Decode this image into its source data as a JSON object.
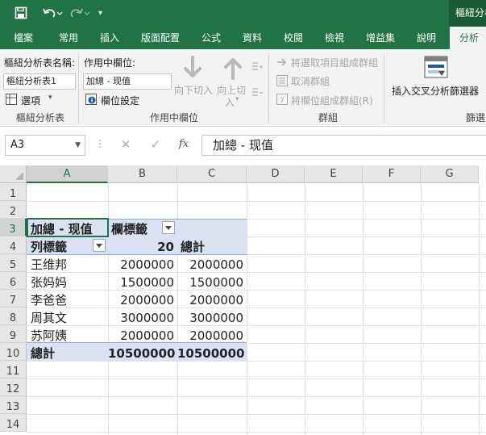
{
  "titlebar": {
    "app_title": "樞紐分析表工具"
  },
  "tabs": [
    "檔案",
    "常用",
    "插入",
    "版面配置",
    "公式",
    "資料",
    "校閱",
    "檢視",
    "增益集",
    "說明",
    "分析"
  ],
  "ribbon": {
    "pivot_name_label": "樞紐分析表名稱:",
    "pivot_name_value": "樞紐分析表1",
    "options_label": "選項",
    "active_field_label": "作用中欄位:",
    "active_field_value": "加總 - 现值",
    "field_settings_label": "欄位設定",
    "drill_down_label": "向下切入",
    "drill_up_label_1": "向上切",
    "drill_up_label_2": "入",
    "group_selection_label": "將選取項目組成群組",
    "ungroup_label": "取消群組",
    "group_field_label": "將欄位組成群組(R)",
    "insert_slicer_label": "插入交叉分析篩選器",
    "group_pivot": "樞紐分析表",
    "group_active_field": "作用中欄位",
    "group_group": "群組",
    "group_filter": "篩選"
  },
  "formula_bar": {
    "name_box": "A3",
    "formula": "加總 - 现值"
  },
  "grid": {
    "columns": [
      "A",
      "B",
      "C",
      "D",
      "E",
      "F",
      "G"
    ],
    "rows": [
      "1",
      "2",
      "3",
      "4",
      "5",
      "6",
      "7",
      "8",
      "9",
      "10",
      "11",
      "12",
      "13",
      "14"
    ],
    "selected_column": "A",
    "selected_row": "3"
  },
  "pivot": {
    "value_header": "加總 - 现值",
    "col_label": "欄標籤",
    "row_label": "列標籤",
    "col_item": "20",
    "total_header": "總計",
    "rows": [
      {
        "name": "王维邦",
        "value": "2000000",
        "total": "2000000"
      },
      {
        "name": "张妈妈",
        "value": "1500000",
        "total": "1500000"
      },
      {
        "name": "李爸爸",
        "value": "2000000",
        "total": "2000000"
      },
      {
        "name": "周其文",
        "value": "3000000",
        "total": "3000000"
      },
      {
        "name": "苏阿姨",
        "value": "2000000",
        "total": "2000000"
      }
    ],
    "grand_total_label": "總計",
    "grand_total_value": "10500000",
    "grand_total_total": "10500000"
  }
}
